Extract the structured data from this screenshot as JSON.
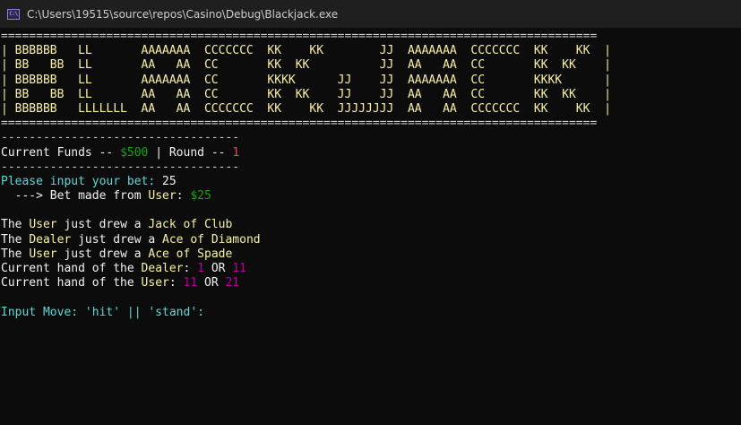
{
  "window": {
    "title": "C:\\Users\\19515\\source\\repos\\Casino\\Debug\\Blackjack.exe",
    "icon": "console-app-icon",
    "icon_text": "C:\\"
  },
  "banner": {
    "border": "=====================================================================================",
    "rows": [
      "| BBBBBB   LL       AAAAAAA  CCCCCCC  KK    KK        JJ  AAAAAAA  CCCCCCC  KK    KK  |",
      "| BB   BB  LL       AA   AA  CC       KK  KK          JJ  AA   AA  CC       KK  KK    |",
      "| BBBBBB   LL       AAAAAAA  CC       KKKK      JJ    JJ  AAAAAAA  CC       KKKK      |",
      "| BB   BB  LL       AA   AA  CC       KK  KK    JJ    JJ  AA   AA  CC       KK  KK    |",
      "| BBBBBB   LLLLLLL  AA   AA  CCCCCCC  KK    KK  JJJJJJJJ  AA   AA  CCCCCCC  KK    KK  |"
    ]
  },
  "status": {
    "dash_line": "----------------------------------",
    "funds_label": "Current Funds -- ",
    "funds_value": "$500",
    "separator": " | ",
    "round_label": "Round -- ",
    "round_value": "1"
  },
  "bet": {
    "prompt": "Please input your bet: ",
    "input_value": "25",
    "made_prefix": "  ---> Bet made from ",
    "made_user": "User",
    "made_colon": ": ",
    "made_amount": "$25"
  },
  "draws": [
    {
      "prefix": "The ",
      "who": "User",
      "mid": " just drew a ",
      "card": "Jack of Club"
    },
    {
      "prefix": "The ",
      "who": "Dealer",
      "mid": " just drew a ",
      "card": "Ace of Diamond"
    },
    {
      "prefix": "The ",
      "who": "User",
      "mid": " just drew a ",
      "card": "Ace of Spade"
    }
  ],
  "hands": [
    {
      "prefix": "Current hand of the ",
      "who": "Dealer",
      "colon": ": ",
      "low": "1",
      "or": " OR ",
      "high": "11"
    },
    {
      "prefix": "Current hand of the ",
      "who": "User",
      "colon": ": ",
      "low": "11",
      "or": " OR ",
      "high": "21"
    }
  ],
  "move_prompt": "Input Move: 'hit' || 'stand':",
  "colors": {
    "background": "#0c0c0c",
    "title_bar": "#1f1f1f",
    "banner": "#f9f1a5",
    "money": "#13a10e",
    "round": "#e74856",
    "prompt": "#61d6d6",
    "hand_value": "#b4009e",
    "text": "#cccccc"
  }
}
